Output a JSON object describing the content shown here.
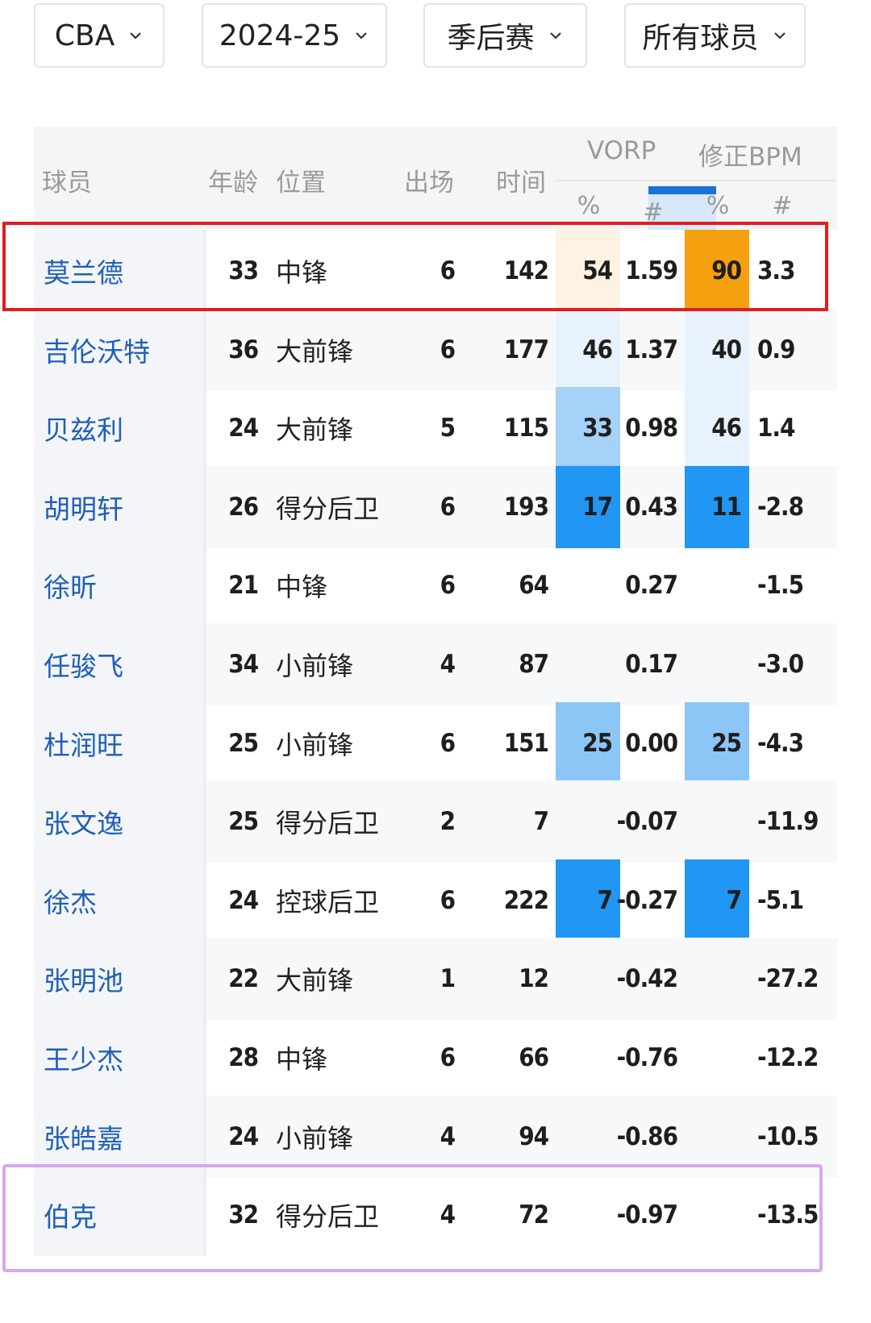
{
  "filters": {
    "league": "CBA",
    "season": "2024-25",
    "phase": "季后赛",
    "players": "所有球员"
  },
  "header": {
    "player": "球员",
    "age": "年龄",
    "position": "位置",
    "games": "出场",
    "minutes": "时间",
    "vorp": "VORP",
    "bpm": "修正BPM",
    "pct": "%",
    "hash": "#"
  },
  "colors": {
    "sort_accent": "#1a73d9",
    "highlight_red": "#e01e1e",
    "highlight_purple": "#d8a7f0",
    "orange": "#f5a00f",
    "pale_orange": "#fff2e3",
    "light_blue": "#e8f2fd",
    "mid_blue": "#a6d1f8",
    "bright_blue": "#2196f3",
    "blue_25": "#8cc6f7",
    "link_blue": "#1f5fb8"
  },
  "rows": [
    {
      "name": "莫兰德",
      "age": "33",
      "pos": "中锋",
      "g": "6",
      "min": "142",
      "vp": "54",
      "vn": "1.59",
      "bp": "90",
      "bn": "3.3"
    },
    {
      "name": "吉伦沃特",
      "age": "36",
      "pos": "大前锋",
      "g": "6",
      "min": "177",
      "vp": "46",
      "vn": "1.37",
      "bp": "40",
      "bn": "0.9"
    },
    {
      "name": "贝兹利",
      "age": "24",
      "pos": "大前锋",
      "g": "5",
      "min": "115",
      "vp": "33",
      "vn": "0.98",
      "bp": "46",
      "bn": "1.4"
    },
    {
      "name": "胡明轩",
      "age": "26",
      "pos": "得分后卫",
      "g": "6",
      "min": "193",
      "vp": "17",
      "vn": "0.43",
      "bp": "11",
      "bn": "-2.8"
    },
    {
      "name": "徐昕",
      "age": "21",
      "pos": "中锋",
      "g": "6",
      "min": "64",
      "vp": "",
      "vn": "0.27",
      "bp": "",
      "bn": "-1.5"
    },
    {
      "name": "任骏飞",
      "age": "34",
      "pos": "小前锋",
      "g": "4",
      "min": "87",
      "vp": "",
      "vn": "0.17",
      "bp": "",
      "bn": "-3.0"
    },
    {
      "name": "杜润旺",
      "age": "25",
      "pos": "小前锋",
      "g": "6",
      "min": "151",
      "vp": "25",
      "vn": "0.00",
      "bp": "25",
      "bn": "-4.3"
    },
    {
      "name": "张文逸",
      "age": "25",
      "pos": "得分后卫",
      "g": "2",
      "min": "7",
      "vp": "",
      "vn": "-0.07",
      "bp": "",
      "bn": "-11.9"
    },
    {
      "name": "徐杰",
      "age": "24",
      "pos": "控球后卫",
      "g": "6",
      "min": "222",
      "vp": "7",
      "vn": "-0.27",
      "bp": "7",
      "bn": "-5.1"
    },
    {
      "name": "张明池",
      "age": "22",
      "pos": "大前锋",
      "g": "1",
      "min": "12",
      "vp": "",
      "vn": "-0.42",
      "bp": "",
      "bn": "-27.2"
    },
    {
      "name": "王少杰",
      "age": "28",
      "pos": "中锋",
      "g": "6",
      "min": "66",
      "vp": "",
      "vn": "-0.76",
      "bp": "",
      "bn": "-12.2"
    },
    {
      "name": "张皓嘉",
      "age": "24",
      "pos": "小前锋",
      "g": "4",
      "min": "94",
      "vp": "",
      "vn": "-0.86",
      "bp": "",
      "bn": "-10.5"
    },
    {
      "name": "伯克",
      "age": "32",
      "pos": "得分后卫",
      "g": "4",
      "min": "72",
      "vp": "",
      "vn": "-0.97",
      "bp": "",
      "bn": "-13.5"
    }
  ]
}
